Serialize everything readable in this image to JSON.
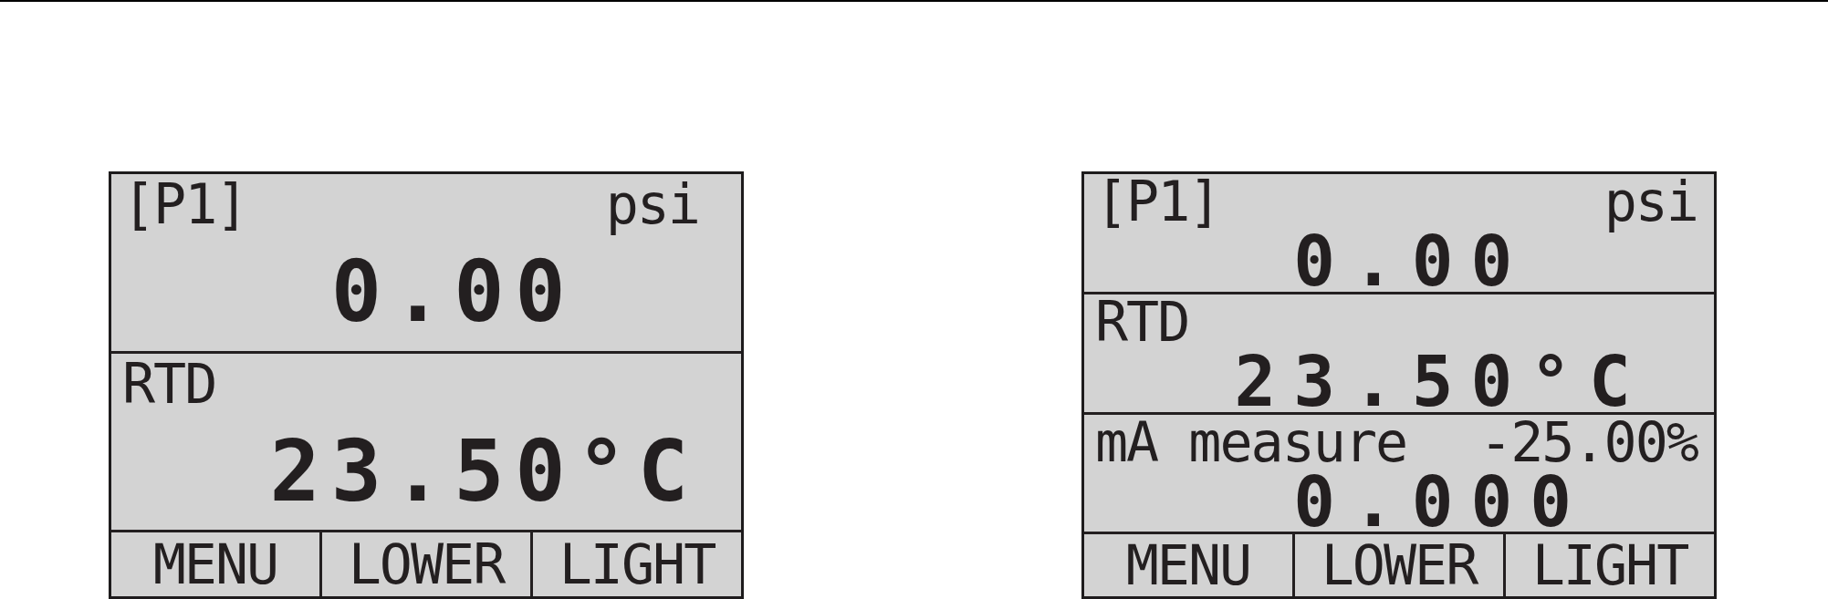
{
  "displays": [
    {
      "rows": [
        {
          "label": "[P1]",
          "unit": "psi",
          "value": "0.00"
        },
        {
          "label": "RTD",
          "value": "23.50°C"
        }
      ],
      "softkeys": [
        "MENU",
        "LOWER",
        "LIGHT"
      ]
    },
    {
      "rows": [
        {
          "label": "[P1]",
          "unit": "psi",
          "value": "0.00"
        },
        {
          "label": "RTD",
          "value": "23.50°C"
        },
        {
          "label": "mA measure",
          "percent": "-25.00%",
          "value": "0.000"
        }
      ],
      "softkeys": [
        "MENU",
        "LOWER",
        "LIGHT"
      ]
    }
  ]
}
